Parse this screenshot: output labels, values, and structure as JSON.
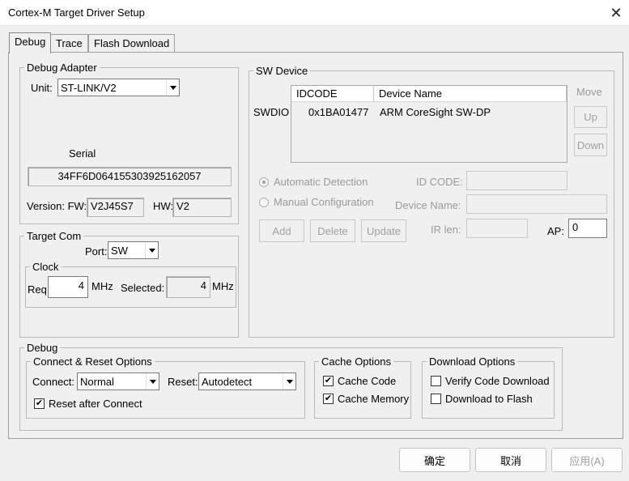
{
  "window": {
    "title": "Cortex-M Target Driver Setup",
    "close": "✕"
  },
  "tabs": [
    {
      "label": "Debug"
    },
    {
      "label": "Trace"
    },
    {
      "label": "Flash Download"
    }
  ],
  "debug_adapter": {
    "legend": "Debug Adapter",
    "unit_label": "Unit:",
    "unit_value": "ST-LINK/V2",
    "serial_label": "Serial",
    "serial_value": "34FF6D064155303925162057",
    "version_label": "Version: FW:",
    "fw_value": "V2J45S7",
    "hw_label": "HW:",
    "hw_value": "V2"
  },
  "target_com": {
    "legend": "Target Com",
    "port_label": "Port:",
    "port_value": "SW",
    "clock": {
      "legend": "Clock",
      "req_label": "Req:",
      "req_value": "4",
      "req_unit": "MHz",
      "selected_label": "Selected:",
      "selected_value": "4",
      "selected_unit": "MHz"
    }
  },
  "sw_device": {
    "legend": "SW Device",
    "swdio_label": "SWDIO",
    "columns": [
      "IDCODE",
      "Device Name"
    ],
    "rows": [
      {
        "idcode": "0x1BA01477",
        "name": "ARM CoreSight SW-DP"
      }
    ],
    "move_label": "Move",
    "up_label": "Up",
    "down_label": "Down",
    "auto_detect_label": "Automatic Detection",
    "manual_config_label": "Manual Configuration",
    "id_code_label": "ID CODE:",
    "device_name_label": "Device Name:",
    "add_label": "Add",
    "delete_label": "Delete",
    "update_label": "Update",
    "ir_len_label": "IR len:",
    "ap_label": "AP:",
    "ap_value": "0"
  },
  "debug": {
    "legend": "Debug",
    "connect_reset": {
      "legend": "Connect & Reset Options",
      "connect_label": "Connect:",
      "connect_value": "Normal",
      "reset_label": "Reset:",
      "reset_value": "Autodetect",
      "reset_after_connect_label": "Reset after Connect",
      "reset_after_connect_checked": true
    },
    "cache_options": {
      "legend": "Cache Options",
      "cache_code_label": "Cache Code",
      "cache_code_checked": true,
      "cache_memory_label": "Cache Memory",
      "cache_memory_checked": true
    },
    "download_options": {
      "legend": "Download Options",
      "verify_label": "Verify Code Download",
      "verify_checked": false,
      "download_flash_label": "Download to Flash",
      "download_flash_checked": false
    }
  },
  "buttons": {
    "ok": "确定",
    "cancel": "取消",
    "apply": "应用(A)"
  },
  "check_glyph": "✔"
}
